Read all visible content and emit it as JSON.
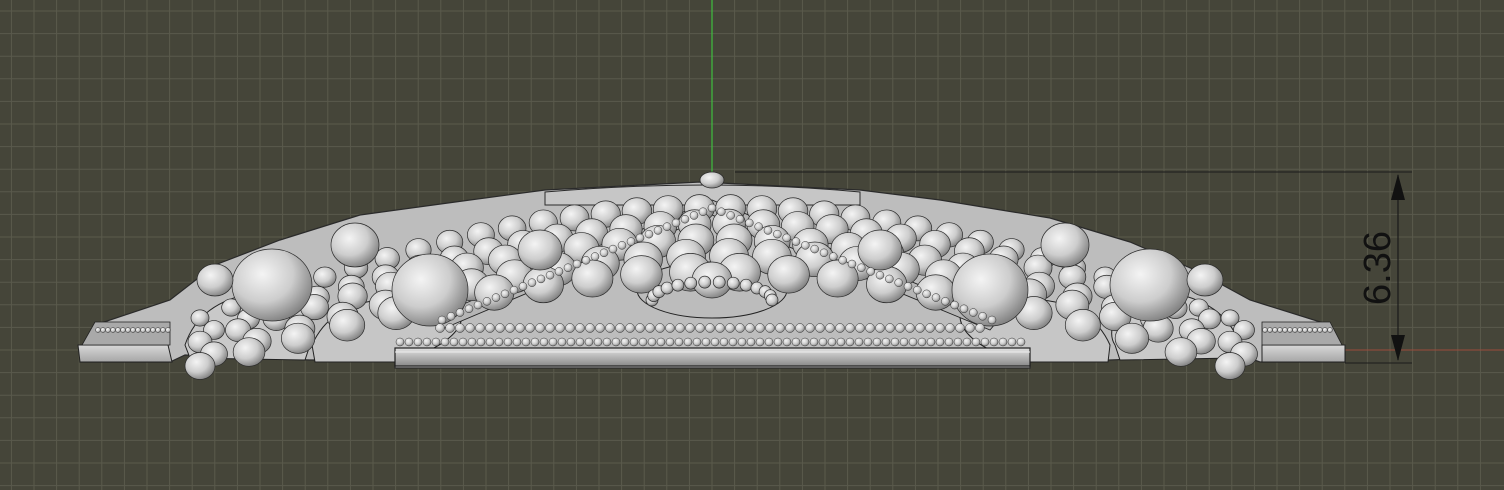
{
  "viewport": {
    "background_color": "#454539",
    "grid_minor_color": "#5a5a4c",
    "grid_major_color": "#66665a",
    "y_axis_color": "#3fbf3f",
    "x_axis_color": "#9a4c3c",
    "model_color": "#cfcfcf"
  },
  "dimension": {
    "value_label": "6.36"
  }
}
